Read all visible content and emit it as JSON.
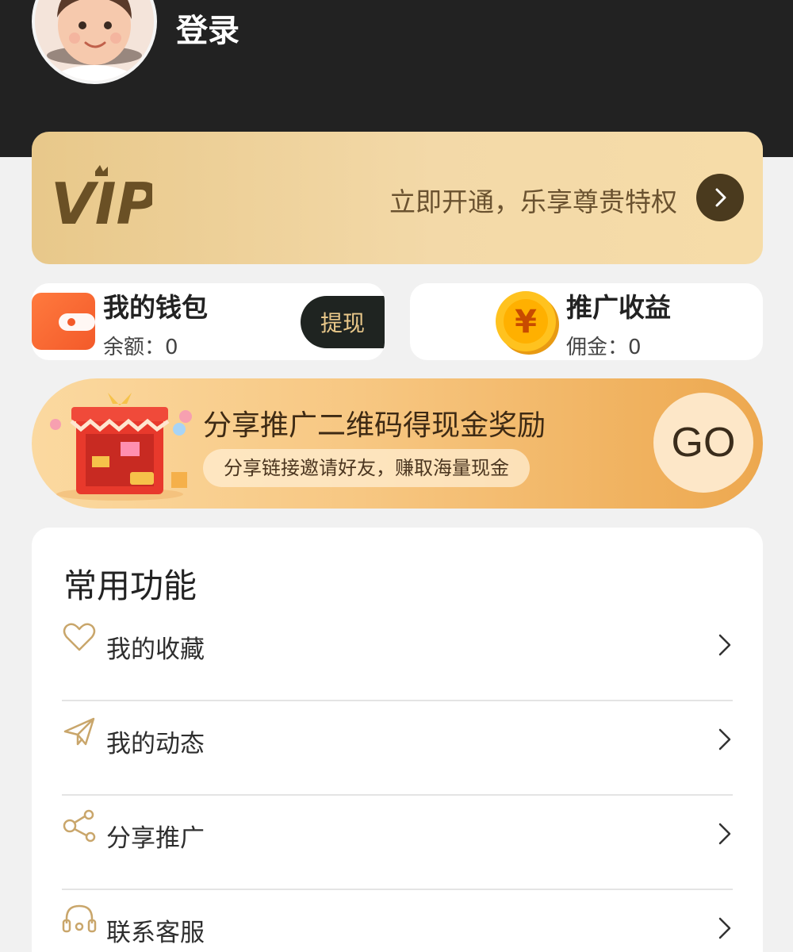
{
  "header": {
    "login_label": "登录"
  },
  "vip": {
    "logo_text": "VIP",
    "tagline": "立即开通，乐享尊贵特权"
  },
  "wallet": {
    "title": "我的钱包",
    "balance": "余额：0",
    "withdraw_label": "提现"
  },
  "earnings": {
    "title": "推广收益",
    "commission": "佣金：0",
    "coin_symbol": "¥"
  },
  "promo": {
    "title": "分享推广二维码得现金奖励",
    "subtitle": "分享链接邀请好友，赚取海量现金",
    "go_label": "GO"
  },
  "functions": {
    "title": "常用功能",
    "items": [
      {
        "label": "我的收藏",
        "icon": "heart-icon"
      },
      {
        "label": "我的动态",
        "icon": "paper-plane-icon"
      },
      {
        "label": "分享推广",
        "icon": "share-icon"
      },
      {
        "label": "联系客服",
        "icon": "headset-icon"
      }
    ]
  },
  "colors": {
    "header_bg": "#222222",
    "vip_gradient_start": "#e8c88a",
    "vip_gradient_end": "#f6dca8",
    "accent_gold": "#c9a66b",
    "withdraw_bg": "#1f2421"
  }
}
